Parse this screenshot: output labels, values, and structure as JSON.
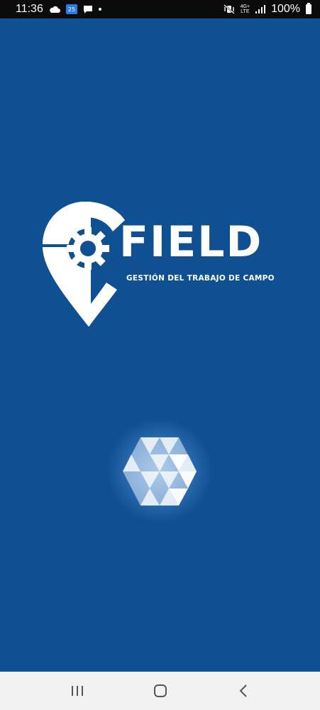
{
  "status_bar": {
    "time": "11:36",
    "network_top": "4G+",
    "network_bottom": "LTE",
    "battery": "100%",
    "icons": [
      "cloud-icon",
      "app-badge-icon",
      "message-icon",
      "notification-dot-icon",
      "mute-vibrate-icon",
      "network-type-icon",
      "signal-icon",
      "battery-icon"
    ],
    "app_badge_text": "25"
  },
  "splash": {
    "brand": "FIELD",
    "tagline": "GESTIÓN DEL TRABAJO DE CAMPO",
    "logo_icon": "location-pin-gear-icon",
    "loader_icon": "hexagon-loading-icon",
    "background_color": "#0f5093"
  },
  "nav_bar": {
    "buttons": [
      "recent-apps-icon",
      "home-icon",
      "back-icon"
    ],
    "background_color": "#f2f2f2"
  }
}
